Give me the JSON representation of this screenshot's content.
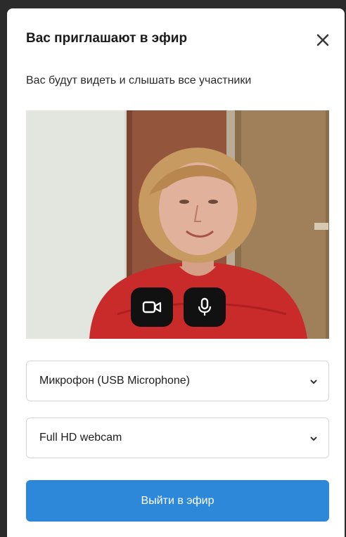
{
  "dialog": {
    "title": "Вас приглашают в эфир",
    "subtitle": "Вас будут видеть и слышать все участники"
  },
  "preview": {
    "camera_icon": "video-camera-icon",
    "mic_icon": "microphone-icon"
  },
  "devices": {
    "microphone": "Микрофон (USB Microphone)",
    "camera": "Full HD webcam"
  },
  "actions": {
    "go_live": "Выйти в эфир"
  },
  "colors": {
    "primary": "#2d88d9",
    "control_bg": "#111111"
  }
}
